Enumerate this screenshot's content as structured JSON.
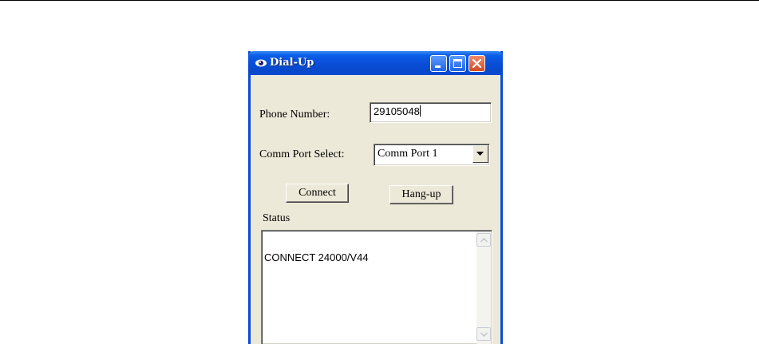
{
  "window": {
    "title": "Dial-Up",
    "icon": "dialup-app-icon",
    "controls": [
      "minimize-icon",
      "maximize-icon",
      "close-icon"
    ]
  },
  "form": {
    "phone_label": "Phone Number:",
    "phone_value": "29105048",
    "port_label": "Comm Port Select:",
    "port_selected": "Comm Port 1"
  },
  "buttons": {
    "connect": "Connect",
    "hangup": "Hang-up"
  },
  "status": {
    "label": "Status",
    "text": "CONNECT 24000/V44"
  },
  "colors": {
    "titlebar": "#0a4ad6",
    "face": "#ece9d8",
    "close": "#d44a22"
  }
}
